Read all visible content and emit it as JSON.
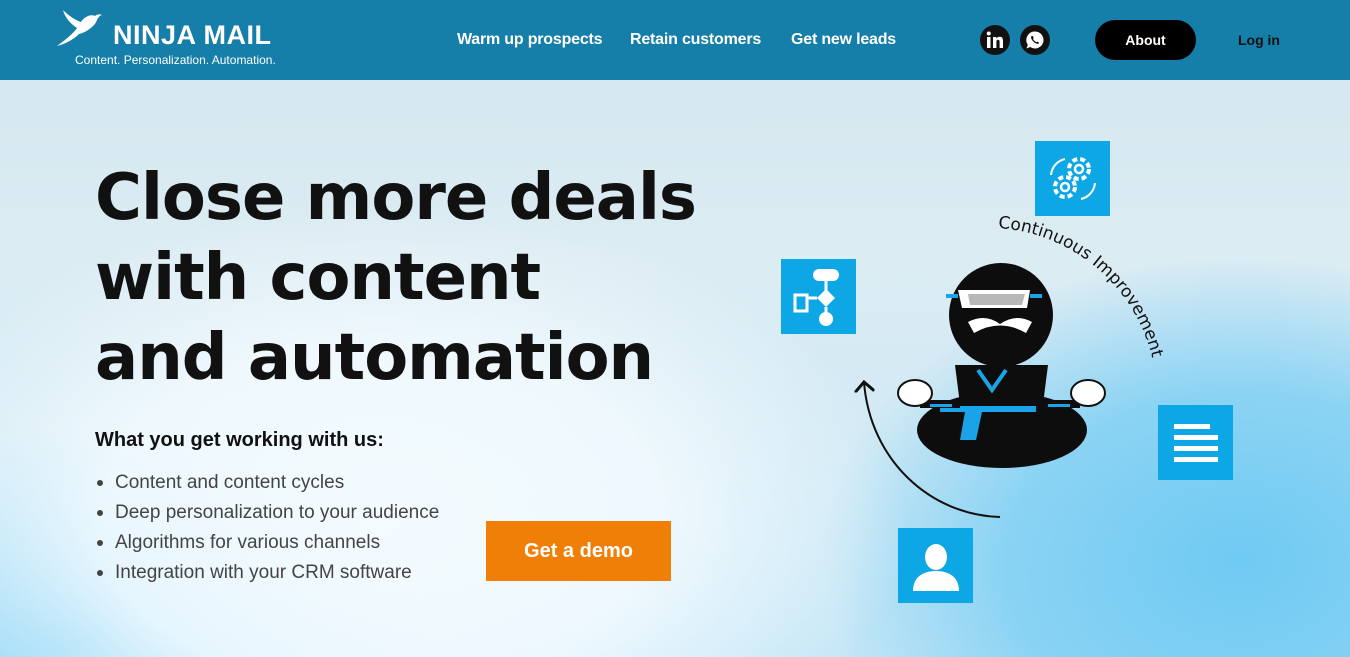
{
  "header": {
    "brand_name": "NINJA MAIL",
    "brand_tagline": "Content. Personalization. Automation.",
    "logo_icon": "bird-icon",
    "nav": [
      {
        "label": "Warm up prospects"
      },
      {
        "label": "Retain customers"
      },
      {
        "label": "Get new leads"
      }
    ],
    "social": [
      {
        "icon": "linkedin-icon"
      },
      {
        "icon": "whatsapp-icon"
      }
    ],
    "about_label": "About",
    "login_label": "Log in",
    "colors": {
      "bar": "#157ea9",
      "about_bg": "#000000"
    }
  },
  "hero": {
    "headline_lines": [
      "Close more deals",
      "with content",
      "and automation"
    ],
    "subheading": "What you get working with us:",
    "benefits": [
      "Content and content cycles",
      "Deep personalization to your audience",
      "Algorithms for various channels",
      "Integration with your CRM software"
    ],
    "cta_label": "Get a demo",
    "cta_color": "#f07f07"
  },
  "illustration": {
    "arc_label": "Continuous Improvement",
    "tiles": [
      {
        "icon": "gears-cycle-icon"
      },
      {
        "icon": "flowchart-icon"
      },
      {
        "icon": "document-lines-icon"
      },
      {
        "icon": "user-icon"
      }
    ],
    "mascot": "meditating-ninja",
    "tile_color": "#0ea7e6"
  }
}
